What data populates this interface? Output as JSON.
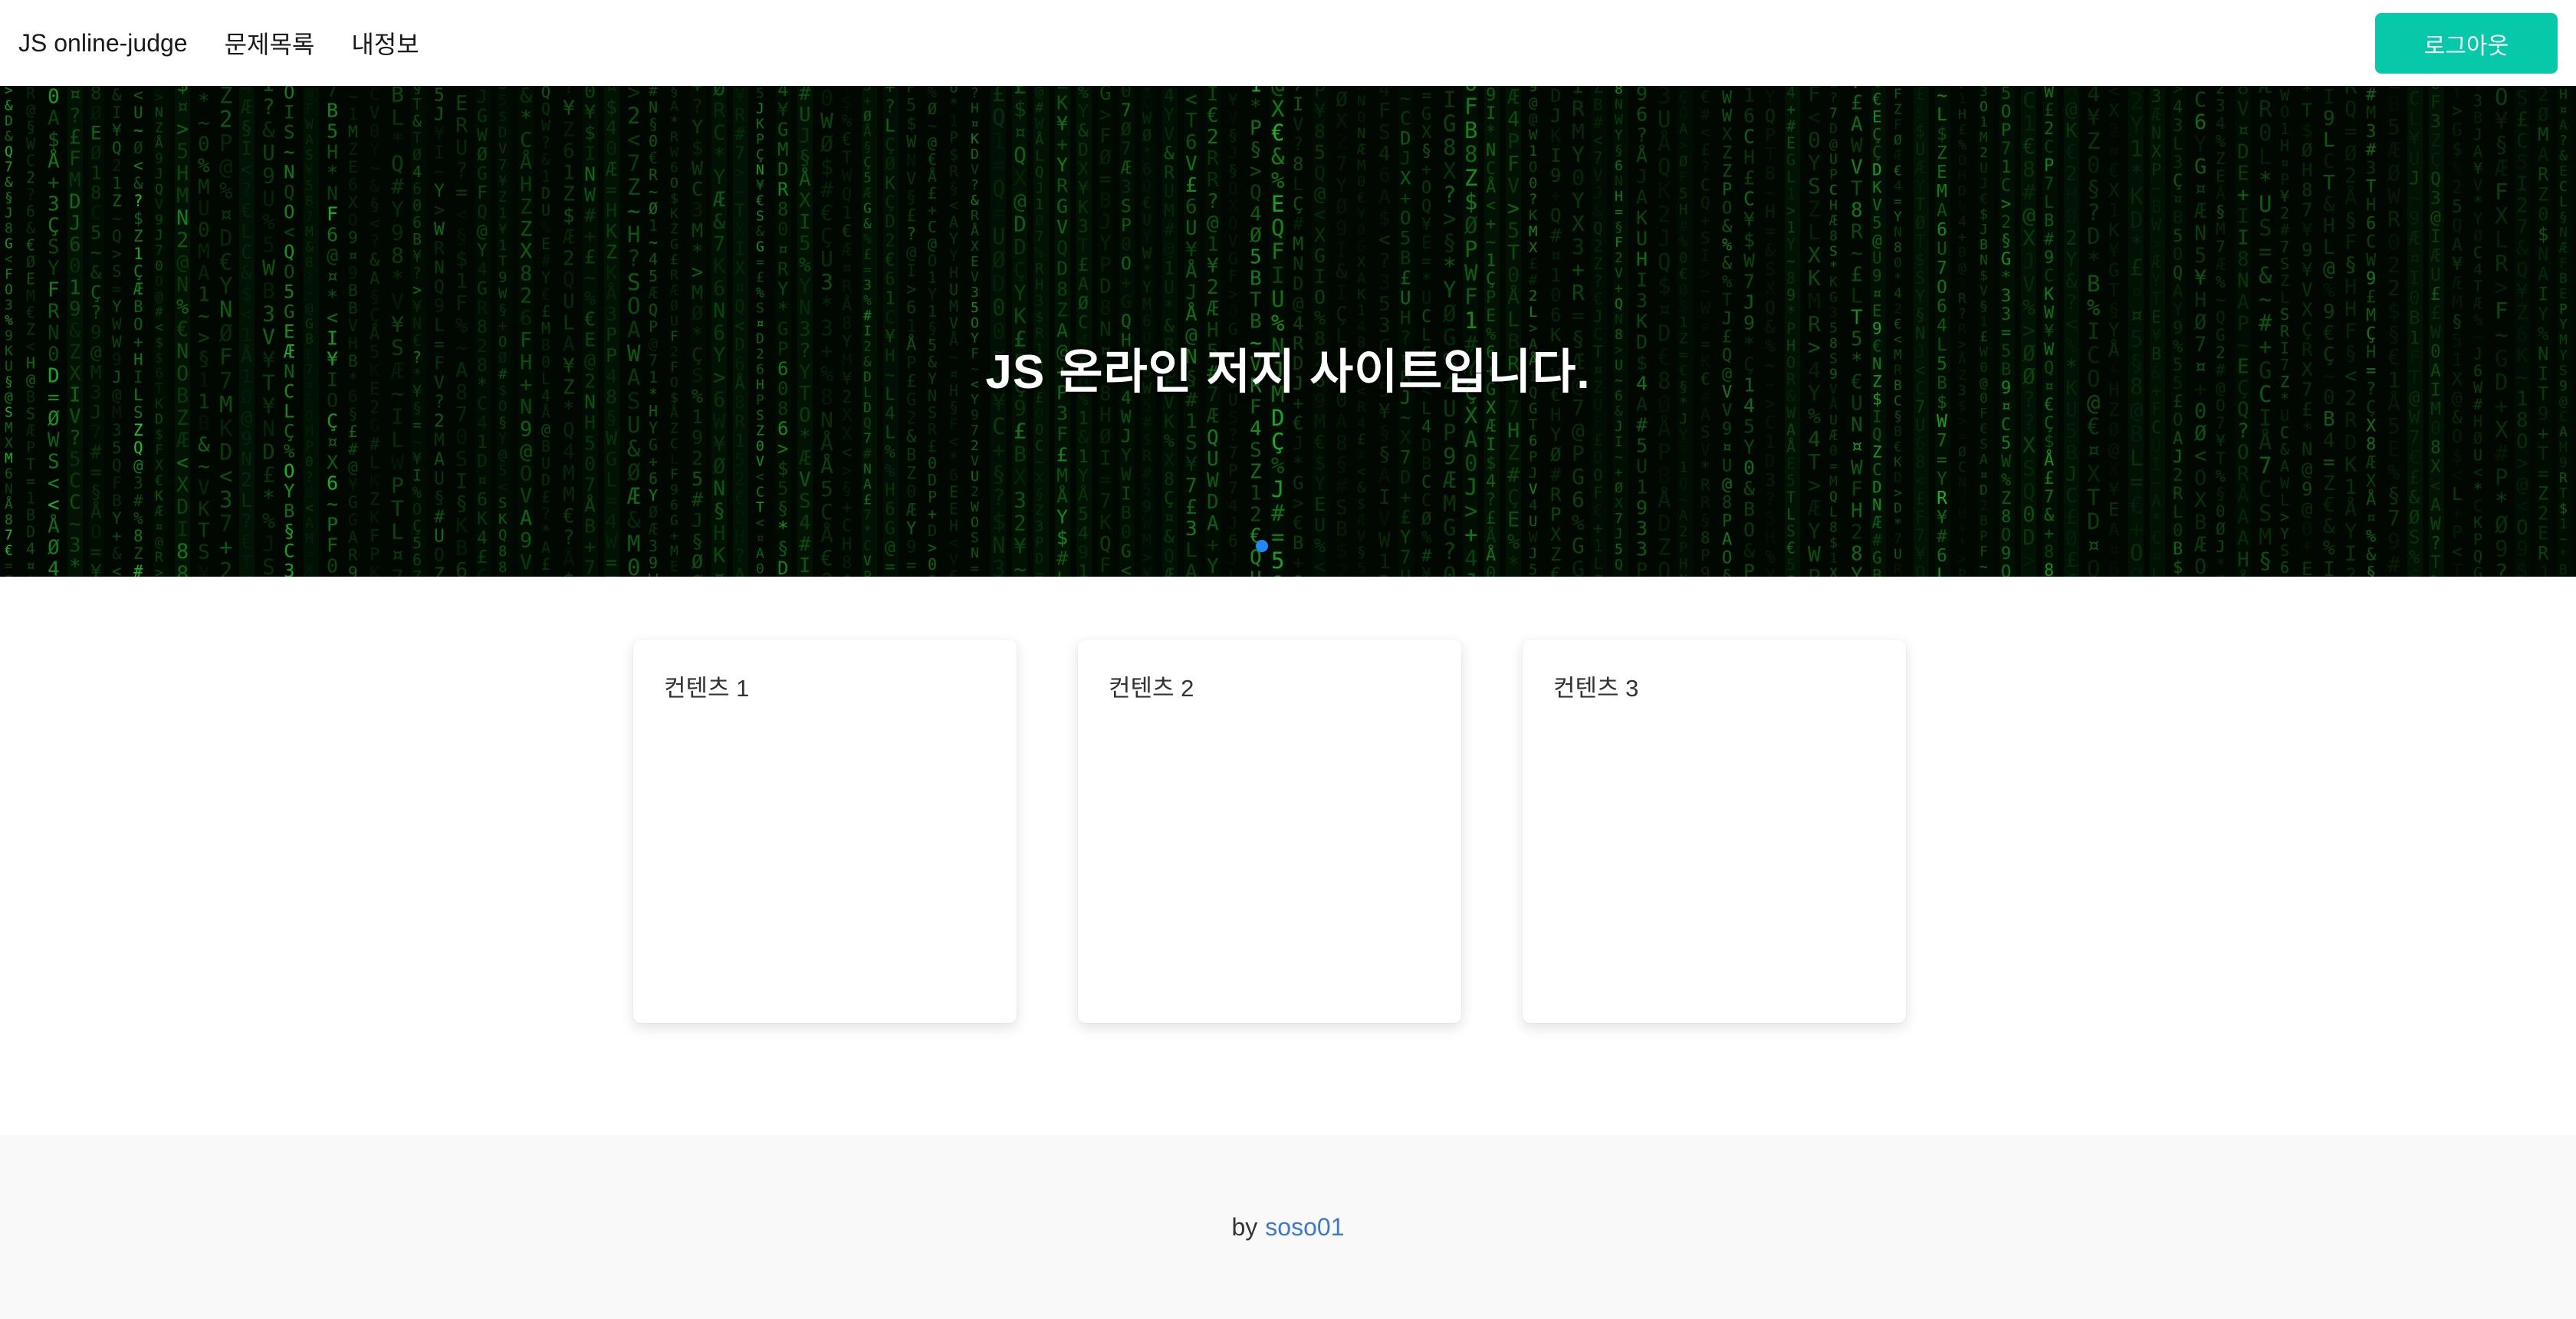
{
  "navbar": {
    "brand": "JS online-judge",
    "links": [
      "문제목록",
      "내정보"
    ],
    "logout_label": "로그아웃",
    "logout_color": "#05c9a9"
  },
  "hero": {
    "title": "JS 온라인 저지 사이트입니다.",
    "background": "green matrix code rain",
    "indicator_color": "#1e88ff"
  },
  "cards": [
    {
      "title": "컨텐츠 1"
    },
    {
      "title": "컨텐츠 2"
    },
    {
      "title": "컨텐츠 3"
    }
  ],
  "footer": {
    "by_label": "by",
    "author": "soso01",
    "link_color": "#3b78d8"
  }
}
